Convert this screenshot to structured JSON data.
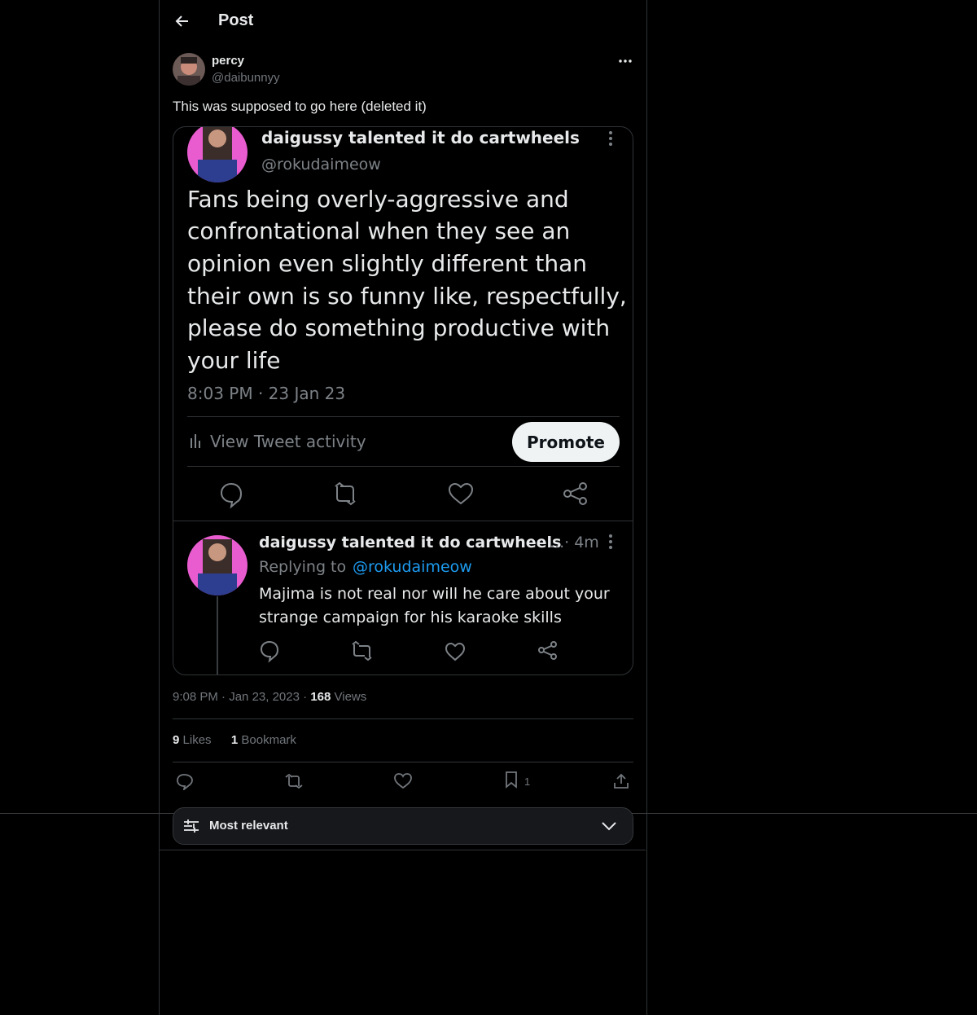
{
  "header": {
    "title": "Post"
  },
  "post": {
    "author_name": "percy",
    "author_handle": "@daibunnyy",
    "text": "This was supposed to go here (deleted it)",
    "time": "9:08 PM",
    "date": "Jan 23, 2023",
    "views_count": "168",
    "views_label": "Views",
    "likes_count": "9",
    "likes_label": "Likes",
    "bookmarks_count": "1",
    "bookmarks_label": "Bookmark",
    "bookmark_action_count": "1"
  },
  "screenshot": {
    "name": "daigussy talented it do cartwheels",
    "handle": "@rokudaimeow",
    "tweet_text_lines": [
      "Fans being overly-aggressive and",
      "confrontational when they see an",
      "opinion even slightly different than",
      "their own is so funny like, respectfully,",
      "please do something productive with",
      "your life"
    ],
    "timestamp": "8:03 PM · 23 Jan 23",
    "view_activity": "View Tweet activity",
    "promote": "Promote",
    "reply": {
      "name": "daigussy talented it do cartwheels",
      "ellipsis_time": "...· 4m",
      "replying_to": "Replying to",
      "replying_handle": "@rokudaimeow",
      "text_lines": [
        "Majima is not real nor will he care about your",
        "strange campaign for his karaoke skills"
      ]
    }
  },
  "sort": {
    "label": "Most relevant"
  },
  "icons": [
    "back-arrow-icon",
    "more-icon",
    "reply-icon",
    "retweet-icon",
    "like-icon",
    "bookmark-icon",
    "share-icon",
    "sliders-icon",
    "chevron-down-icon"
  ],
  "colors": {
    "background": "#000000",
    "text": "#e7e9ea",
    "muted": "#71767b",
    "border": "#2f3336",
    "link": "#1d9bf0"
  }
}
